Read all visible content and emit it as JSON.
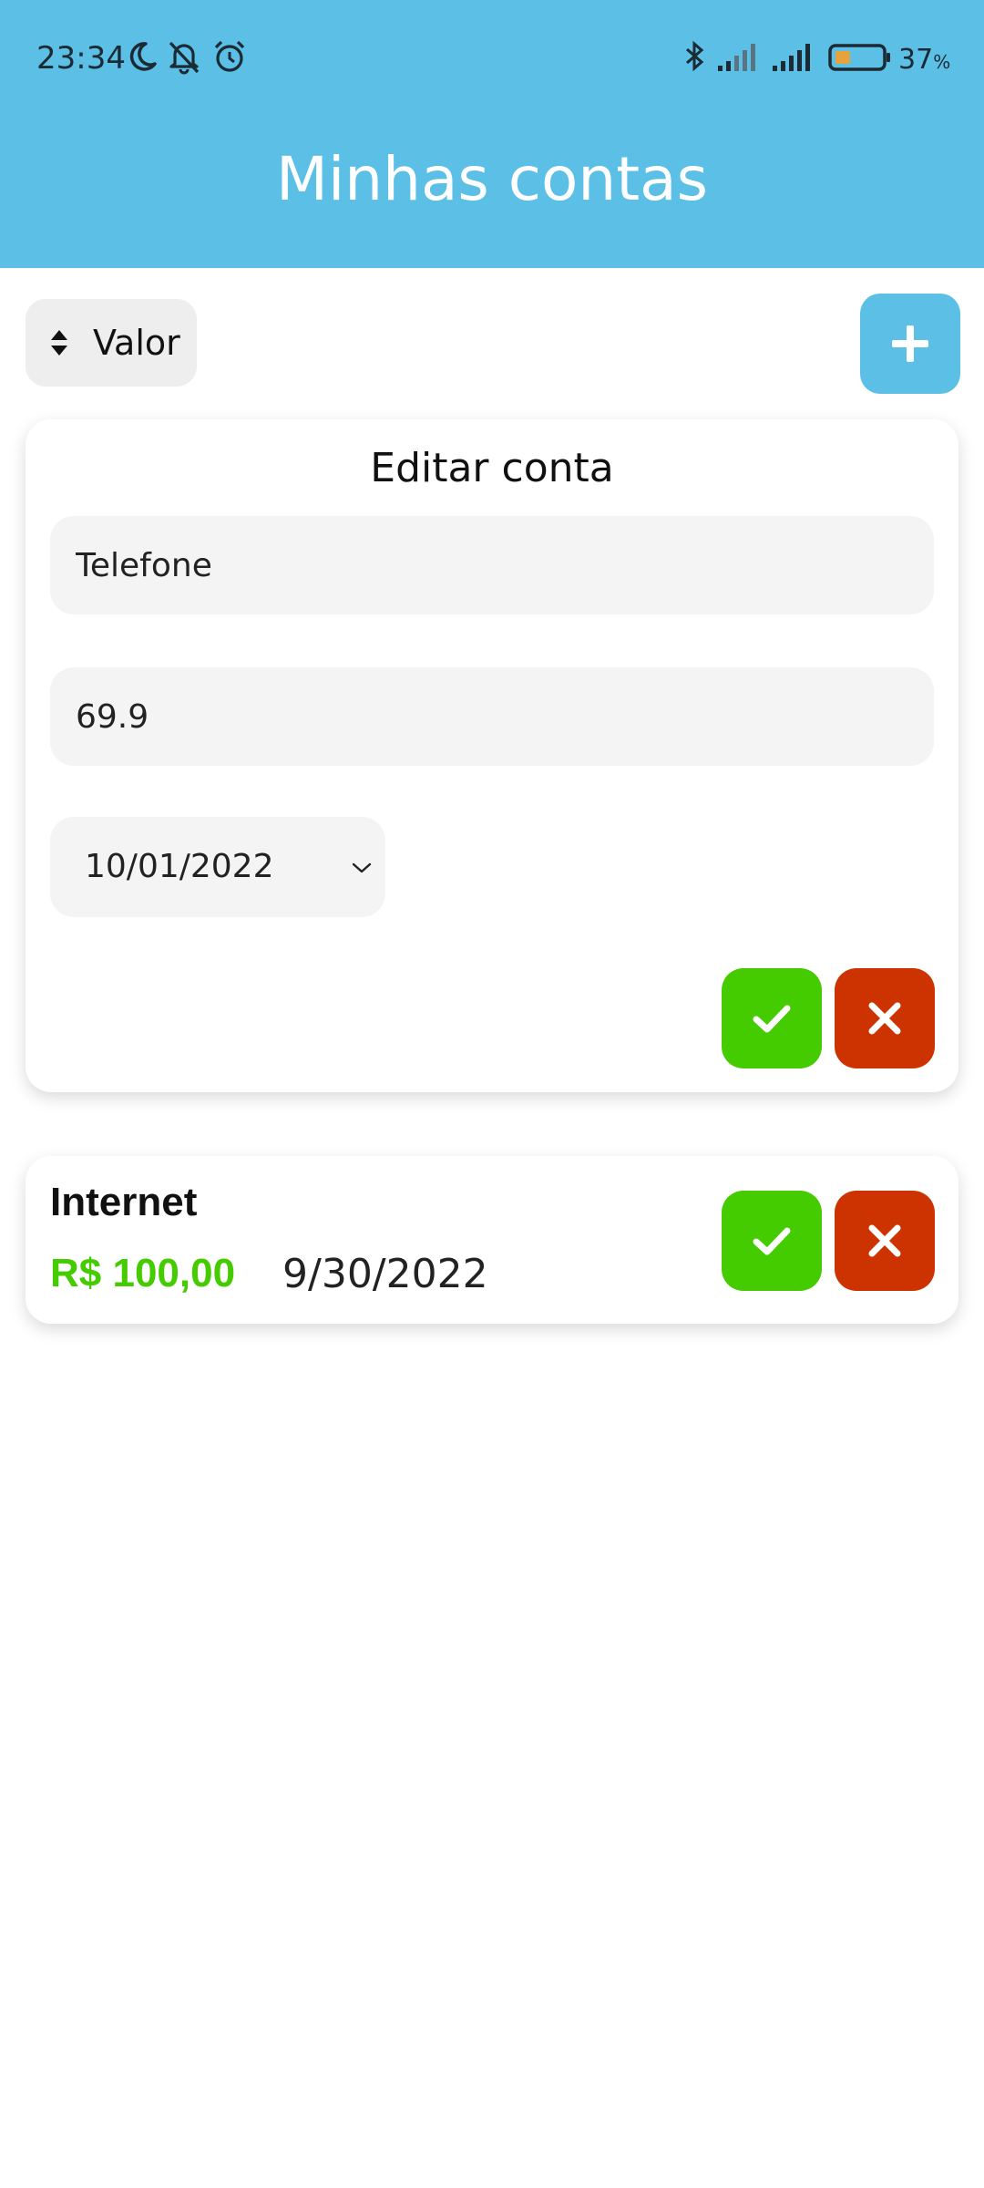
{
  "status_bar": {
    "time": "23:34",
    "battery_percent": "37",
    "battery_symbol": "%",
    "icons": [
      "moon-icon",
      "bell-off-icon",
      "alarm-icon",
      "bluetooth-icon",
      "signal-1-icon",
      "signal-2-icon",
      "battery-icon"
    ]
  },
  "header": {
    "title": "Minhas contas",
    "color": "#5bbfe6"
  },
  "toolbar": {
    "sort_label": "Valor",
    "sort_icon": "sort-icon",
    "add_icon": "plus-icon"
  },
  "edit_form": {
    "title": "Editar conta",
    "name_value": "Telefone",
    "amount_value": "69.9",
    "date_value": "10/01/2022",
    "confirm_icon": "check-icon",
    "cancel_icon": "close-icon"
  },
  "bills": [
    {
      "name": "Internet",
      "amount": "R$ 100,00",
      "date": "9/30/2022"
    }
  ],
  "colors": {
    "accent": "#5bbfe6",
    "confirm": "#44cc00",
    "cancel": "#cc3300",
    "amount": "#44cc00"
  }
}
